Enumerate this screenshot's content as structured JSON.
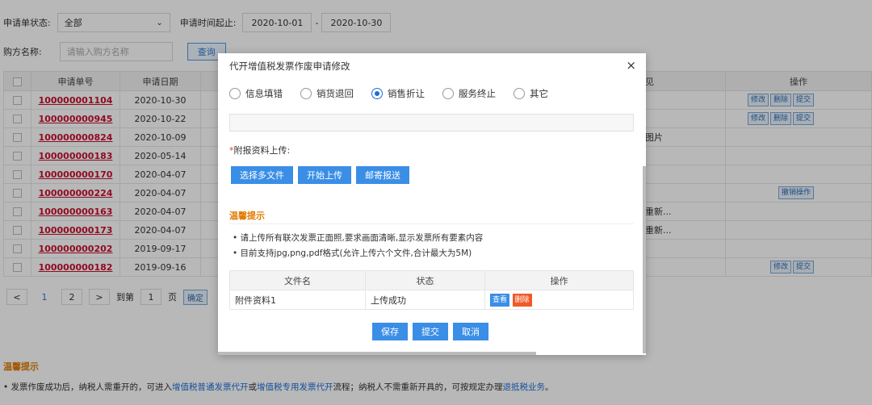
{
  "filters": {
    "status_label": "申请单状态:",
    "status_value": "全部",
    "time_label": "申请时间起止:",
    "date_from": "2020-10-01",
    "date_sep": "-",
    "date_to": "2020-10-30",
    "buyer_label": "购方名称:",
    "buyer_placeholder": "请输入购方名称",
    "query_label": "查询"
  },
  "table": {
    "headers": [
      "",
      "申请单号",
      "申请日期",
      "",
      "",
      "见",
      "操作"
    ],
    "rows": [
      {
        "no": "100000001104",
        "date": "2020-10-30",
        "note": "",
        "ops": [
          "修改",
          "删除",
          "提交"
        ]
      },
      {
        "no": "100000000945",
        "date": "2020-10-22",
        "note": "",
        "ops": [
          "修改",
          "删除",
          "提交"
        ]
      },
      {
        "no": "100000000824",
        "date": "2020-10-09",
        "note": "图片",
        "ops": []
      },
      {
        "no": "100000000183",
        "date": "2020-05-14",
        "note": "",
        "ops": []
      },
      {
        "no": "100000000170",
        "date": "2020-04-07",
        "note": "",
        "ops": []
      },
      {
        "no": "100000000224",
        "date": "2020-04-07",
        "note": "",
        "ops": [
          "撤销操作"
        ]
      },
      {
        "no": "100000000163",
        "date": "2020-04-07",
        "note": "重新...",
        "ops": []
      },
      {
        "no": "100000000173",
        "date": "2020-04-07",
        "note": "重新...",
        "ops": []
      },
      {
        "no": "100000000202",
        "date": "2019-09-17",
        "note": "",
        "ops": []
      },
      {
        "no": "100000000182",
        "date": "2019-09-16",
        "note": "",
        "ops": [
          "修改",
          "提交"
        ]
      }
    ]
  },
  "pager": {
    "prev": "<",
    "page1": "1",
    "page2": "2",
    "next": ">",
    "goto_label": "到第",
    "goto_value": "1",
    "page_unit": "页",
    "confirm": "确定"
  },
  "bottom_tips": {
    "title": "温馨提示",
    "text_a": "• 发票作废成功后，纳税人需重开的，可进入",
    "link_a": "增值税普通发票代开",
    "text_b": "或",
    "link_b": "增值税专用发票代开",
    "text_c": "流程；纳税人不需重新开具的，可按规定办理",
    "link_c": "退抵税业务",
    "text_d": "。"
  },
  "modal": {
    "title": "代开增值税发票作废申请修改",
    "close": "×",
    "reasons": [
      {
        "label": "信息填错",
        "checked": false
      },
      {
        "label": "销货退回",
        "checked": false
      },
      {
        "label": "销售折让",
        "checked": true
      },
      {
        "label": "服务终止",
        "checked": false
      },
      {
        "label": "其它",
        "checked": false
      }
    ],
    "upload_star": "*",
    "upload_label": "附报资料上传:",
    "btn_select": "选择多文件",
    "btn_upload": "开始上传",
    "btn_mail": "邮寄报送",
    "warm_title": "温馨提示",
    "warm_1": "请上传所有联次发票正面照,要求画面清晰,显示发票所有要素内容",
    "warm_2": "目前支持jpg,png,pdf格式(允许上传六个文件,合计最大为5M)",
    "file_headers": {
      "name": "文件名",
      "status": "状态",
      "ops": "操作"
    },
    "file_row": {
      "name": "附件资料1",
      "status": "上传成功",
      "view": "查看",
      "del": "删除"
    },
    "btn_save": "保存",
    "btn_submit": "提交",
    "btn_cancel": "取消"
  }
}
